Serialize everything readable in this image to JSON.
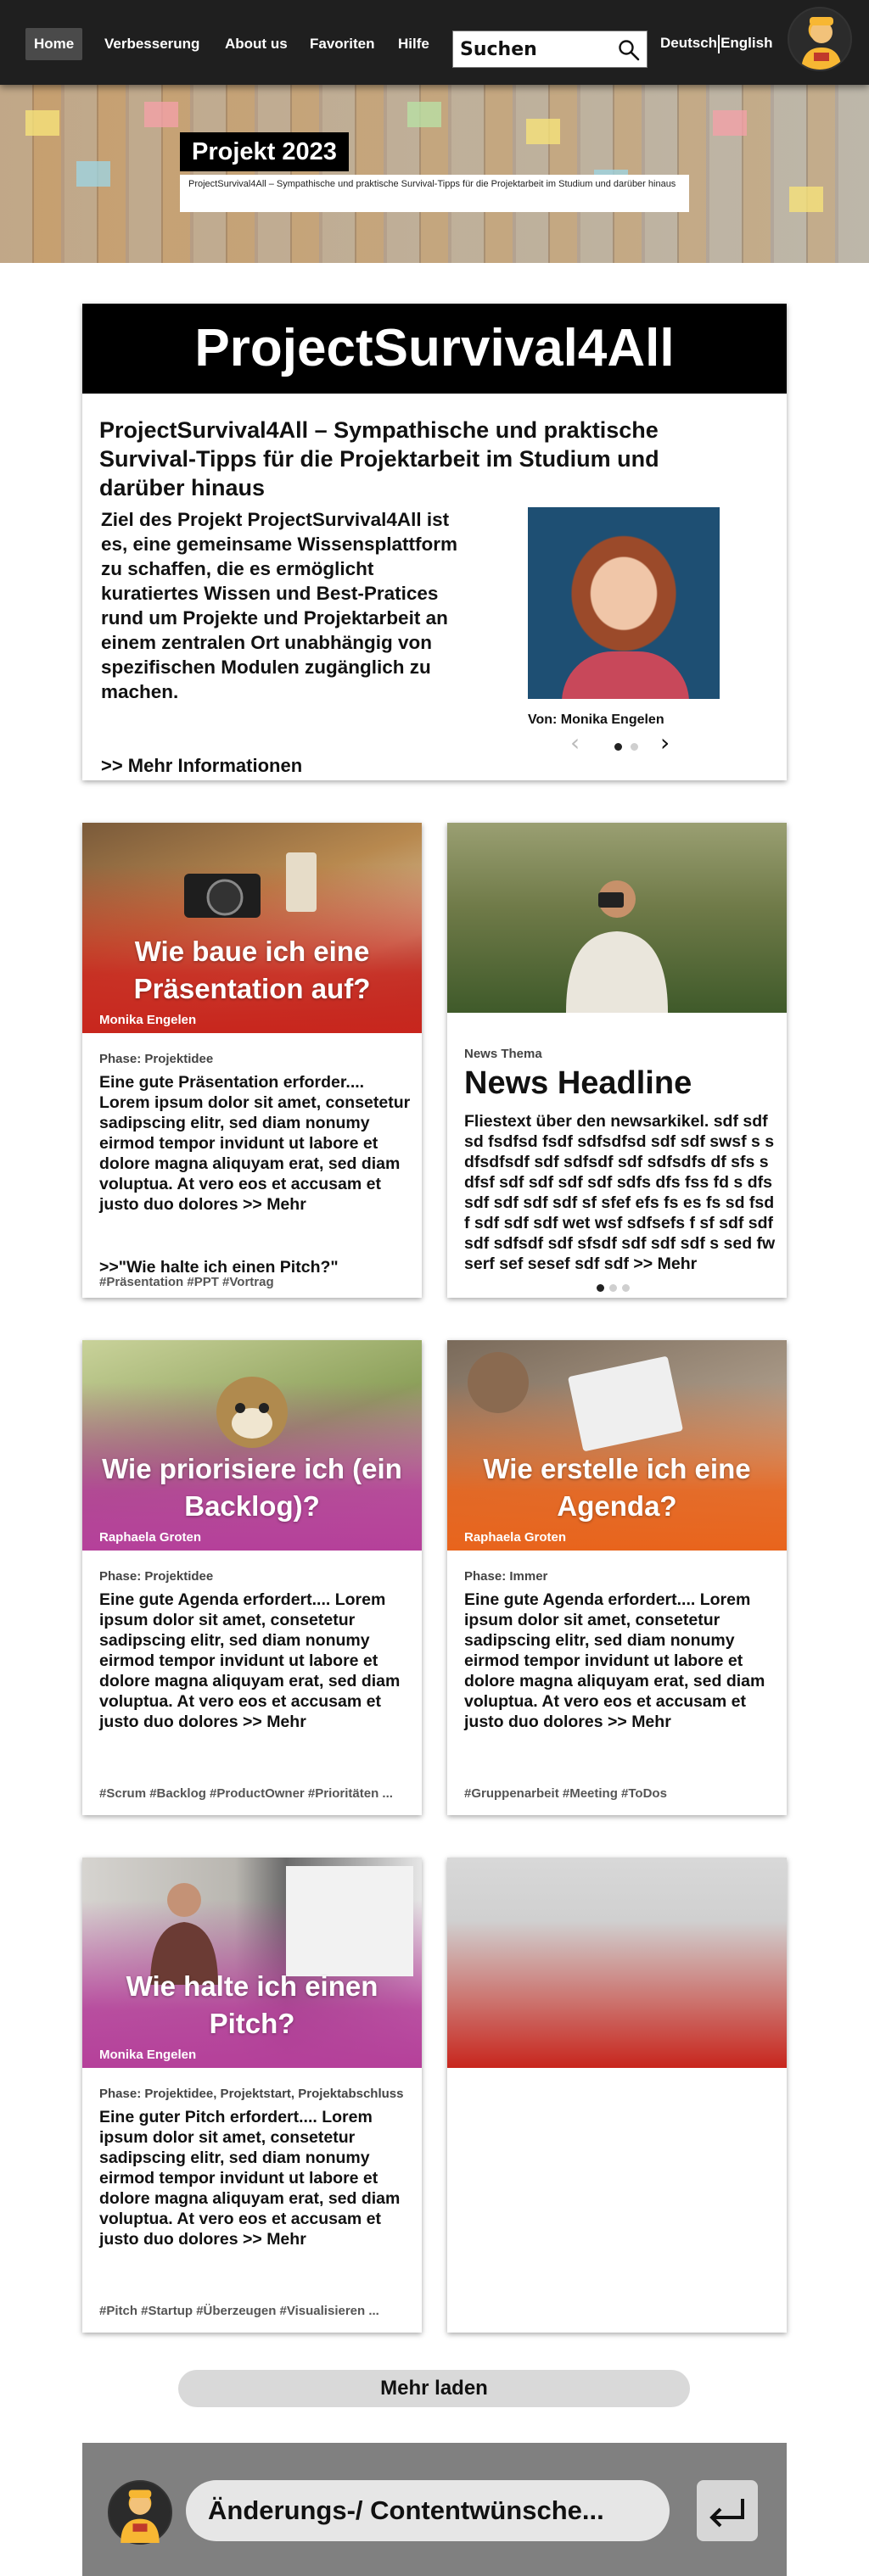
{
  "nav": {
    "items": [
      {
        "label": "Home",
        "active": true
      },
      {
        "label": "Verbesserung"
      },
      {
        "label": "About us"
      },
      {
        "label": "Favoriten"
      },
      {
        "label": "Hilfe"
      }
    ],
    "search_placeholder": "Suchen",
    "lang_de": "Deutsch",
    "lang_en": "English"
  },
  "hero": {
    "title": "Projekt 2023",
    "subtitle": "ProjectSurvival4All – Sympathische und praktische Survival-Tipps für die Projektarbeit im Studium und darüber hinaus"
  },
  "feature": {
    "banner": "ProjectSurvival4All",
    "heading": "ProjectSurvival4All – Sympathische und praktische Survival-Tipps für die Projektarbeit im Studium und darüber hinaus",
    "text": "Ziel des Projekt ProjectSurvival4All ist es, eine gemeinsame Wissensplattform zu schaffen, die es ermöglicht kuratiertes Wissen und Best-Pratices rund um Projekte und Projektarbeit an einem zentralen Ort unabhängig von spezifischen Modulen zugänglich zu machen.",
    "more": ">> Mehr Informationen",
    "byline": "Von: Monika Engelen",
    "prev": "‹",
    "next": "›"
  },
  "cards": {
    "c1": {
      "title": "Wie baue ich eine Präsentation auf?",
      "author": "Monika Engelen",
      "phase": "Phase: Projektidee",
      "body": "Eine gute Präsentation erforder.... Lorem ipsum dolor sit amet, consetetur sadipscing elitr, sed diam nonumy eirmod tempor invidunt ut labore et dolore magna aliquyam erat, sed diam voluptua. At vero eos et accusam et justo duo dolores  >> Mehr",
      "extra": ">>\"Wie halte ich einen Pitch?\"",
      "tags": "#Präsentation #PPT #Vortrag"
    },
    "news": {
      "kicker": "News Thema",
      "headline": "News Headline",
      "body": "Fliestext über den newsarkikel. sdf sdf sd fsdfsd fsdf sdfsdfsd sdf sdf swsf s s dfsdfsdf sdf sdfsdf sdf sdfsdfs df sfs s dfsf sdf sdf sdf sdf sdfs dfs fss fd s dfs sdf sdf sdf sdf sf sfef efs fs es fs sd fsdf sdf sdf sdf wet wsf sdfsefs f sf sdf sdfsdf sdfsdf sdf sfsdf sdf sdf sdf s sed fwserf sef sesef sdf sdf >> Mehr"
    },
    "c3": {
      "title": "Wie priorisiere ich (ein Backlog)?",
      "author": "Raphaela Groten",
      "phase": "Phase: Projektidee",
      "body": "Eine gute Agenda erfordert.... Lorem ipsum dolor sit amet, consetetur sadipscing elitr, sed diam nonumy eirmod tempor invidunt ut labore et dolore magna aliquyam erat, sed diam voluptua. At vero eos et accusam et justo duo dolores  >> Mehr",
      "tags": "#Scrum #Backlog #ProductOwner #Prioritäten ..."
    },
    "c4": {
      "title": "Wie erstelle ich eine Agenda?",
      "author": "Raphaela Groten",
      "phase": "Phase: Immer",
      "body": "Eine gute Agenda erfordert.... Lorem ipsum dolor sit amet, consetetur sadipscing elitr, sed diam nonumy eirmod tempor invidunt ut labore et dolore magna aliquyam erat, sed diam voluptua. At vero eos et accusam et justo duo dolores  >> Mehr",
      "tags": "#Gruppenarbeit #Meeting #ToDos"
    },
    "c5": {
      "title": "Wie halte ich einen Pitch?",
      "author": "Monika Engelen",
      "phase": "Phase: Projektidee, Projektstart, Projektabschluss",
      "body": "Eine guter Pitch erfordert.... Lorem ipsum dolor sit amet, consetetur sadipscing elitr, sed diam nonumy eirmod tempor invidunt ut labore et dolore magna aliquyam erat, sed diam voluptua. At vero eos et accusam et justo duo dolores  >> Mehr",
      "tags": "#Pitch #Startup #Überzeugen #Visualisieren ..."
    }
  },
  "load_more": "Mehr laden",
  "footer": {
    "placeholder": "Änderungs-/ Contentwünsche..."
  },
  "colors": {
    "nav_bg": "#1f1f1f",
    "red_gradient": "#c8261d",
    "purple_gradient": "#b5409a",
    "orange_gradient": "#e8641c",
    "footer_bg": "#808080"
  }
}
